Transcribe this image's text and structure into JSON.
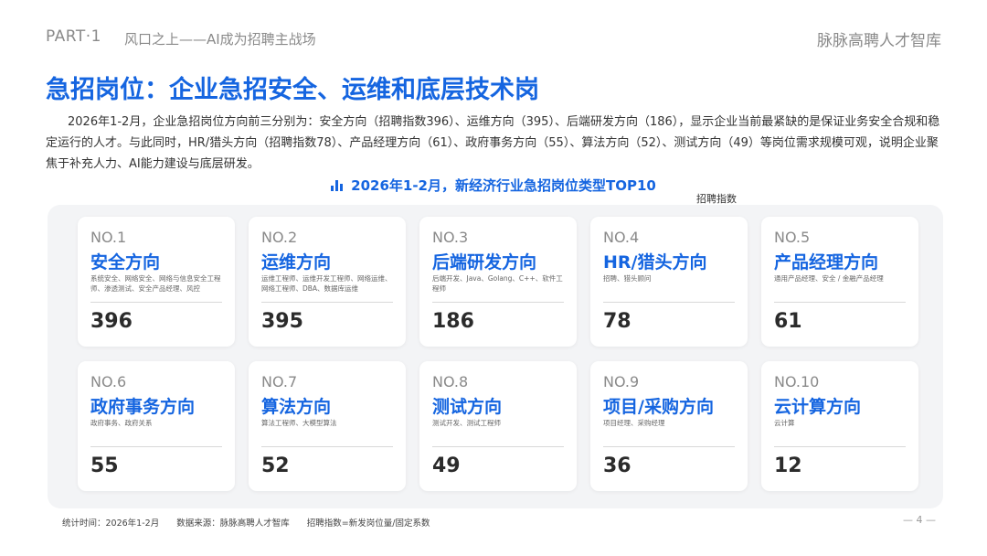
{
  "header": {
    "part": "PART·1",
    "section": "风口之上——AI成为招聘主战场",
    "brand": "脉脉高聘人才智库"
  },
  "title": "急招岗位：企业急招安全、运维和底层技术岗",
  "intro": "2026年1-2月，企业急招岗位方向前三分别为：安全方向（招聘指数396）、运维方向（395）、后端研发方向（186），显示企业当前最紧缺的是保证业务安全合规和稳定运行的人才。与此同时，HR/猎头方向（招聘指数78）、产品经理方向（61）、政府事务方向（55）、算法方向（52）、测试方向（49）等岗位需求规模可观，说明企业聚焦于补充人力、AI能力建设与底层研发。",
  "chart": {
    "title": "2026年1-2月，新经济行业急招岗位类型TOP10",
    "index_label": "招聘指数",
    "accent_color": "#1565e0"
  },
  "chart_data": {
    "type": "table",
    "title": "2026年1-2月，新经济行业急招岗位类型TOP10",
    "value_label": "招聘指数",
    "rows": [
      {
        "rank": "NO.1",
        "name": "安全方向",
        "desc": "系统安全、网络安全、网络与信息安全工程师、渗透测试、安全产品经理、风控",
        "value": 396
      },
      {
        "rank": "NO.2",
        "name": "运维方向",
        "desc": "运维工程师、运维开发工程师、网络运维、网络工程师、DBA、数据库运维",
        "value": 395
      },
      {
        "rank": "NO.3",
        "name": "后端研发方向",
        "desc": "后端开发、Java、Golang、C++、软件工程师",
        "value": 186
      },
      {
        "rank": "NO.4",
        "name": "HR/猎头方向",
        "desc": "招聘、猎头顾问",
        "value": 78
      },
      {
        "rank": "NO.5",
        "name": "产品经理方向",
        "desc": "通用产品经理、安全 / 金融产品经理",
        "value": 61
      },
      {
        "rank": "NO.6",
        "name": "政府事务方向",
        "desc": "政府事务、政府关系",
        "value": 55
      },
      {
        "rank": "NO.7",
        "name": "算法方向",
        "desc": "算法工程师、大模型算法",
        "value": 52
      },
      {
        "rank": "NO.8",
        "name": "测试方向",
        "desc": "测试开发、测试工程师",
        "value": 49
      },
      {
        "rank": "NO.9",
        "name": "项目/采购方向",
        "desc": "项目经理、采购经理",
        "value": 36
      },
      {
        "rank": "NO.10",
        "name": "云计算方向",
        "desc": "云计算",
        "value": 12
      }
    ]
  },
  "footer": {
    "stat_time": "统计时间：2026年1-2月",
    "source": "数据来源：脉脉高聘人才智库",
    "formula": "招聘指数=新发岗位量/固定系数",
    "page": "— 4 —"
  }
}
